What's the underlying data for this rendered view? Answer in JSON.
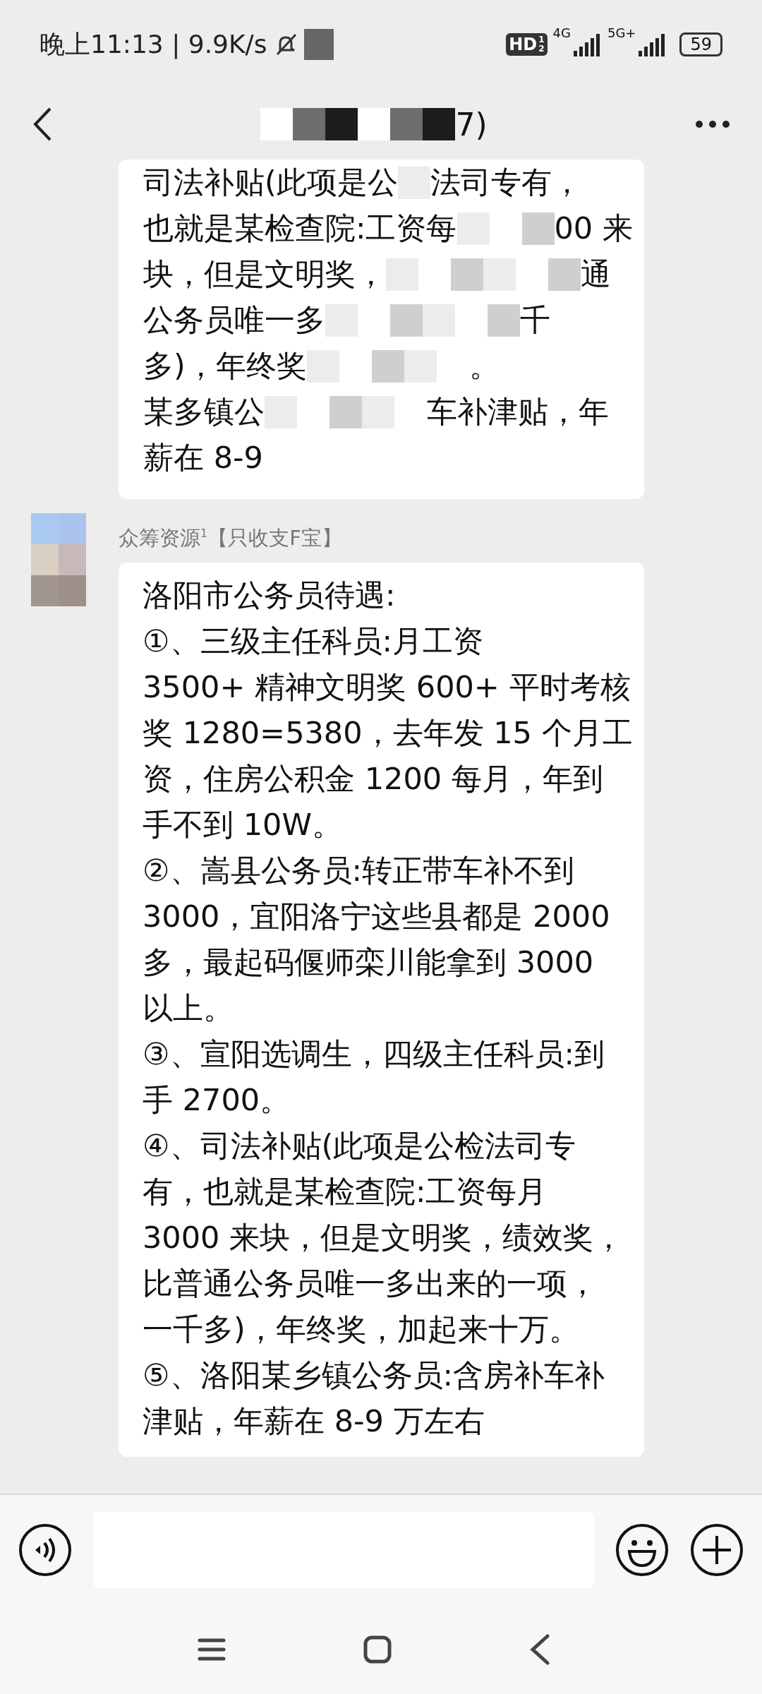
{
  "status_bar": {
    "time": "晚上11:13 | 9.9K/s",
    "hd": "HD",
    "hd_sub": [
      "1",
      "2"
    ],
    "net1": "4G",
    "net2": "5G+",
    "battery": "59"
  },
  "header": {
    "title": [
      {
        "kind": "mosaic"
      },
      {
        "kind": "text",
        "text": "7)"
      }
    ]
  },
  "messages": [
    {
      "kind": "cut",
      "lines": [
        [
          {
            "kind": "text",
            "text": "司法补贴(此项是公"
          },
          {
            "kind": "mosaic"
          },
          {
            "kind": "text",
            "text": "法司专有，"
          }
        ],
        [
          {
            "kind": "text",
            "text": "也就是某检查院:工资每"
          },
          {
            "kind": "mosaic"
          },
          {
            "kind": "text",
            "text": "00 来"
          }
        ],
        [
          {
            "kind": "text",
            "text": "块，但是文明奖，"
          },
          {
            "kind": "mosaic"
          },
          {
            "kind": "text",
            "text": "通"
          }
        ],
        [
          {
            "kind": "text",
            "text": "公务员唯一多"
          },
          {
            "kind": "mosaic"
          },
          {
            "kind": "text",
            "text": "千"
          }
        ],
        [
          {
            "kind": "text",
            "text": "多)，年终奖"
          },
          {
            "kind": "mosaic"
          },
          {
            "kind": "text",
            "text": "。"
          }
        ],
        [
          {
            "kind": "text",
            "text": "某多镇公"
          },
          {
            "kind": "mosaic"
          },
          {
            "kind": "text",
            "text": "车补津贴，年"
          }
        ],
        [
          {
            "kind": "text",
            "text": "薪在 8-9"
          }
        ]
      ]
    },
    {
      "kind": "incoming",
      "sender": "众筹资源$^{1}$【只收支F宝】",
      "lines": [
        "洛阳市公务员待遇:",
        "①、三级主任科员:月工资",
        "3500+ 精神文明奖 600+ 平时考核",
        "奖 1280=5380，去年发 15 个月工",
        "资，住房公积金 1200 每月，年到",
        "手不到 10W。",
        "②、嵩县公务员:转正带车补不到",
        "3000，宜阳洛宁这些县都是 2000",
        "多，最起码偃师栾川能拿到 3000",
        "以上。",
        "③、宣阳选调生，四级主任科员:到",
        "手 2700。",
        "④、司法补贴(此项是公检法司专",
        "有，也就是某检查院:工资每月",
        "3000 来块，但是文明奖，绩效奖，",
        "比普通公务员唯一多出来的一项，",
        "一千多)，年终奖，加起来十万。",
        "⑤、洛阳某乡镇公务员:含房补车补",
        "津贴，年薪在 8-9 万左右"
      ]
    }
  ]
}
